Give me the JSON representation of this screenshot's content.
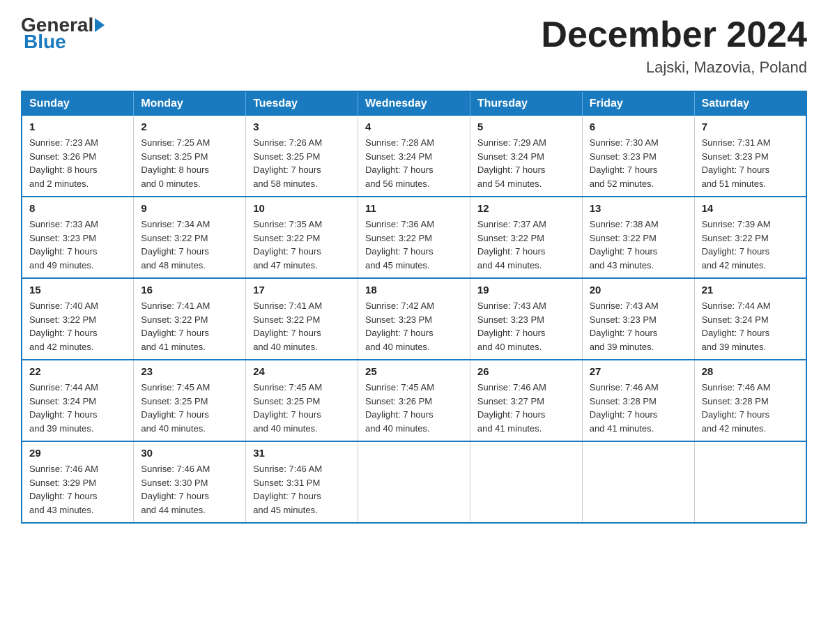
{
  "logo": {
    "general": "General",
    "blue": "Blue"
  },
  "header": {
    "month_title": "December 2024",
    "subtitle": "Lajski, Mazovia, Poland"
  },
  "days_of_week": [
    "Sunday",
    "Monday",
    "Tuesday",
    "Wednesday",
    "Thursday",
    "Friday",
    "Saturday"
  ],
  "weeks": [
    [
      {
        "day": "1",
        "sunrise": "7:23 AM",
        "sunset": "3:26 PM",
        "daylight": "8 hours and 2 minutes."
      },
      {
        "day": "2",
        "sunrise": "7:25 AM",
        "sunset": "3:25 PM",
        "daylight": "8 hours and 0 minutes."
      },
      {
        "day": "3",
        "sunrise": "7:26 AM",
        "sunset": "3:25 PM",
        "daylight": "7 hours and 58 minutes."
      },
      {
        "day": "4",
        "sunrise": "7:28 AM",
        "sunset": "3:24 PM",
        "daylight": "7 hours and 56 minutes."
      },
      {
        "day": "5",
        "sunrise": "7:29 AM",
        "sunset": "3:24 PM",
        "daylight": "7 hours and 54 minutes."
      },
      {
        "day": "6",
        "sunrise": "7:30 AM",
        "sunset": "3:23 PM",
        "daylight": "7 hours and 52 minutes."
      },
      {
        "day": "7",
        "sunrise": "7:31 AM",
        "sunset": "3:23 PM",
        "daylight": "7 hours and 51 minutes."
      }
    ],
    [
      {
        "day": "8",
        "sunrise": "7:33 AM",
        "sunset": "3:23 PM",
        "daylight": "7 hours and 49 minutes."
      },
      {
        "day": "9",
        "sunrise": "7:34 AM",
        "sunset": "3:22 PM",
        "daylight": "7 hours and 48 minutes."
      },
      {
        "day": "10",
        "sunrise": "7:35 AM",
        "sunset": "3:22 PM",
        "daylight": "7 hours and 47 minutes."
      },
      {
        "day": "11",
        "sunrise": "7:36 AM",
        "sunset": "3:22 PM",
        "daylight": "7 hours and 45 minutes."
      },
      {
        "day": "12",
        "sunrise": "7:37 AM",
        "sunset": "3:22 PM",
        "daylight": "7 hours and 44 minutes."
      },
      {
        "day": "13",
        "sunrise": "7:38 AM",
        "sunset": "3:22 PM",
        "daylight": "7 hours and 43 minutes."
      },
      {
        "day": "14",
        "sunrise": "7:39 AM",
        "sunset": "3:22 PM",
        "daylight": "7 hours and 42 minutes."
      }
    ],
    [
      {
        "day": "15",
        "sunrise": "7:40 AM",
        "sunset": "3:22 PM",
        "daylight": "7 hours and 42 minutes."
      },
      {
        "day": "16",
        "sunrise": "7:41 AM",
        "sunset": "3:22 PM",
        "daylight": "7 hours and 41 minutes."
      },
      {
        "day": "17",
        "sunrise": "7:41 AM",
        "sunset": "3:22 PM",
        "daylight": "7 hours and 40 minutes."
      },
      {
        "day": "18",
        "sunrise": "7:42 AM",
        "sunset": "3:23 PM",
        "daylight": "7 hours and 40 minutes."
      },
      {
        "day": "19",
        "sunrise": "7:43 AM",
        "sunset": "3:23 PM",
        "daylight": "7 hours and 40 minutes."
      },
      {
        "day": "20",
        "sunrise": "7:43 AM",
        "sunset": "3:23 PM",
        "daylight": "7 hours and 39 minutes."
      },
      {
        "day": "21",
        "sunrise": "7:44 AM",
        "sunset": "3:24 PM",
        "daylight": "7 hours and 39 minutes."
      }
    ],
    [
      {
        "day": "22",
        "sunrise": "7:44 AM",
        "sunset": "3:24 PM",
        "daylight": "7 hours and 39 minutes."
      },
      {
        "day": "23",
        "sunrise": "7:45 AM",
        "sunset": "3:25 PM",
        "daylight": "7 hours and 40 minutes."
      },
      {
        "day": "24",
        "sunrise": "7:45 AM",
        "sunset": "3:25 PM",
        "daylight": "7 hours and 40 minutes."
      },
      {
        "day": "25",
        "sunrise": "7:45 AM",
        "sunset": "3:26 PM",
        "daylight": "7 hours and 40 minutes."
      },
      {
        "day": "26",
        "sunrise": "7:46 AM",
        "sunset": "3:27 PM",
        "daylight": "7 hours and 41 minutes."
      },
      {
        "day": "27",
        "sunrise": "7:46 AM",
        "sunset": "3:28 PM",
        "daylight": "7 hours and 41 minutes."
      },
      {
        "day": "28",
        "sunrise": "7:46 AM",
        "sunset": "3:28 PM",
        "daylight": "7 hours and 42 minutes."
      }
    ],
    [
      {
        "day": "29",
        "sunrise": "7:46 AM",
        "sunset": "3:29 PM",
        "daylight": "7 hours and 43 minutes."
      },
      {
        "day": "30",
        "sunrise": "7:46 AM",
        "sunset": "3:30 PM",
        "daylight": "7 hours and 44 minutes."
      },
      {
        "day": "31",
        "sunrise": "7:46 AM",
        "sunset": "3:31 PM",
        "daylight": "7 hours and 45 minutes."
      },
      null,
      null,
      null,
      null
    ]
  ],
  "labels": {
    "sunrise": "Sunrise:",
    "sunset": "Sunset:",
    "daylight": "Daylight:"
  }
}
